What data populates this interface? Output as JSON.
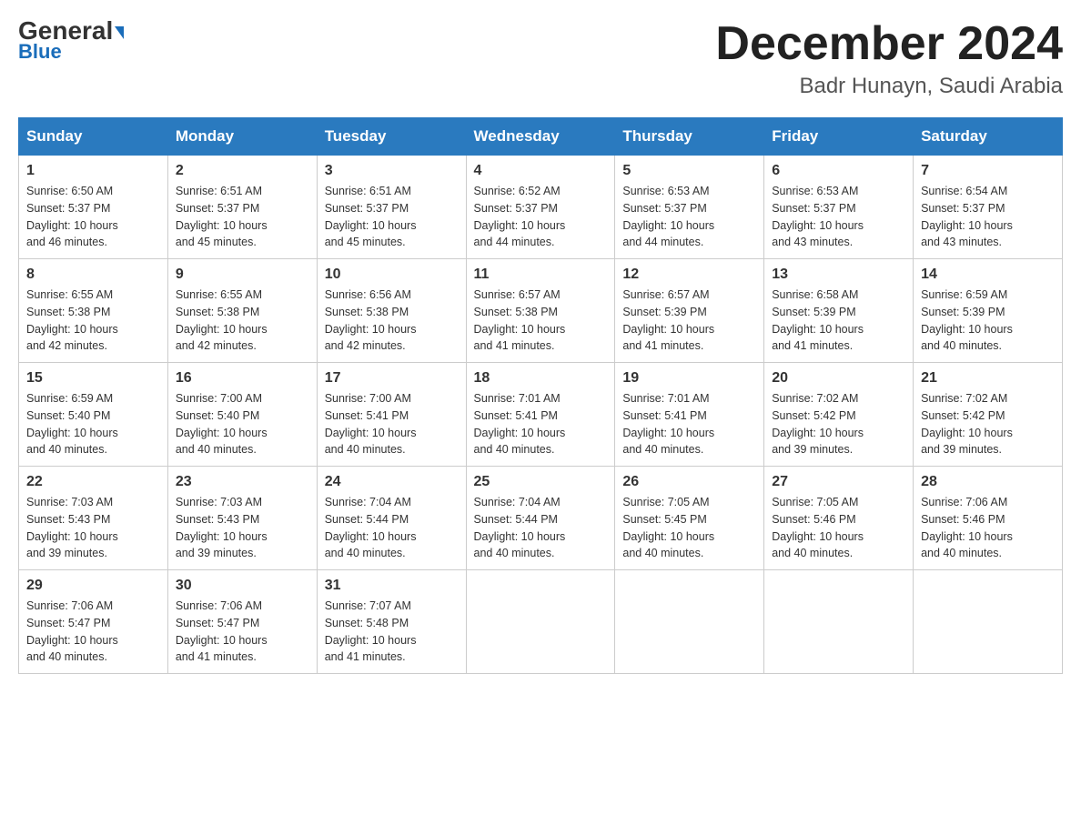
{
  "logo": {
    "general": "General",
    "blue": "Blue"
  },
  "title": "December 2024",
  "location": "Badr Hunayn, Saudi Arabia",
  "days_of_week": [
    "Sunday",
    "Monday",
    "Tuesday",
    "Wednesday",
    "Thursday",
    "Friday",
    "Saturday"
  ],
  "weeks": [
    [
      {
        "day": "1",
        "sunrise": "6:50 AM",
        "sunset": "5:37 PM",
        "daylight": "10 hours and 46 minutes."
      },
      {
        "day": "2",
        "sunrise": "6:51 AM",
        "sunset": "5:37 PM",
        "daylight": "10 hours and 45 minutes."
      },
      {
        "day": "3",
        "sunrise": "6:51 AM",
        "sunset": "5:37 PM",
        "daylight": "10 hours and 45 minutes."
      },
      {
        "day": "4",
        "sunrise": "6:52 AM",
        "sunset": "5:37 PM",
        "daylight": "10 hours and 44 minutes."
      },
      {
        "day": "5",
        "sunrise": "6:53 AM",
        "sunset": "5:37 PM",
        "daylight": "10 hours and 44 minutes."
      },
      {
        "day": "6",
        "sunrise": "6:53 AM",
        "sunset": "5:37 PM",
        "daylight": "10 hours and 43 minutes."
      },
      {
        "day": "7",
        "sunrise": "6:54 AM",
        "sunset": "5:37 PM",
        "daylight": "10 hours and 43 minutes."
      }
    ],
    [
      {
        "day": "8",
        "sunrise": "6:55 AM",
        "sunset": "5:38 PM",
        "daylight": "10 hours and 42 minutes."
      },
      {
        "day": "9",
        "sunrise": "6:55 AM",
        "sunset": "5:38 PM",
        "daylight": "10 hours and 42 minutes."
      },
      {
        "day": "10",
        "sunrise": "6:56 AM",
        "sunset": "5:38 PM",
        "daylight": "10 hours and 42 minutes."
      },
      {
        "day": "11",
        "sunrise": "6:57 AM",
        "sunset": "5:38 PM",
        "daylight": "10 hours and 41 minutes."
      },
      {
        "day": "12",
        "sunrise": "6:57 AM",
        "sunset": "5:39 PM",
        "daylight": "10 hours and 41 minutes."
      },
      {
        "day": "13",
        "sunrise": "6:58 AM",
        "sunset": "5:39 PM",
        "daylight": "10 hours and 41 minutes."
      },
      {
        "day": "14",
        "sunrise": "6:59 AM",
        "sunset": "5:39 PM",
        "daylight": "10 hours and 40 minutes."
      }
    ],
    [
      {
        "day": "15",
        "sunrise": "6:59 AM",
        "sunset": "5:40 PM",
        "daylight": "10 hours and 40 minutes."
      },
      {
        "day": "16",
        "sunrise": "7:00 AM",
        "sunset": "5:40 PM",
        "daylight": "10 hours and 40 minutes."
      },
      {
        "day": "17",
        "sunrise": "7:00 AM",
        "sunset": "5:41 PM",
        "daylight": "10 hours and 40 minutes."
      },
      {
        "day": "18",
        "sunrise": "7:01 AM",
        "sunset": "5:41 PM",
        "daylight": "10 hours and 40 minutes."
      },
      {
        "day": "19",
        "sunrise": "7:01 AM",
        "sunset": "5:41 PM",
        "daylight": "10 hours and 40 minutes."
      },
      {
        "day": "20",
        "sunrise": "7:02 AM",
        "sunset": "5:42 PM",
        "daylight": "10 hours and 39 minutes."
      },
      {
        "day": "21",
        "sunrise": "7:02 AM",
        "sunset": "5:42 PM",
        "daylight": "10 hours and 39 minutes."
      }
    ],
    [
      {
        "day": "22",
        "sunrise": "7:03 AM",
        "sunset": "5:43 PM",
        "daylight": "10 hours and 39 minutes."
      },
      {
        "day": "23",
        "sunrise": "7:03 AM",
        "sunset": "5:43 PM",
        "daylight": "10 hours and 39 minutes."
      },
      {
        "day": "24",
        "sunrise": "7:04 AM",
        "sunset": "5:44 PM",
        "daylight": "10 hours and 40 minutes."
      },
      {
        "day": "25",
        "sunrise": "7:04 AM",
        "sunset": "5:44 PM",
        "daylight": "10 hours and 40 minutes."
      },
      {
        "day": "26",
        "sunrise": "7:05 AM",
        "sunset": "5:45 PM",
        "daylight": "10 hours and 40 minutes."
      },
      {
        "day": "27",
        "sunrise": "7:05 AM",
        "sunset": "5:46 PM",
        "daylight": "10 hours and 40 minutes."
      },
      {
        "day": "28",
        "sunrise": "7:06 AM",
        "sunset": "5:46 PM",
        "daylight": "10 hours and 40 minutes."
      }
    ],
    [
      {
        "day": "29",
        "sunrise": "7:06 AM",
        "sunset": "5:47 PM",
        "daylight": "10 hours and 40 minutes."
      },
      {
        "day": "30",
        "sunrise": "7:06 AM",
        "sunset": "5:47 PM",
        "daylight": "10 hours and 41 minutes."
      },
      {
        "day": "31",
        "sunrise": "7:07 AM",
        "sunset": "5:48 PM",
        "daylight": "10 hours and 41 minutes."
      },
      null,
      null,
      null,
      null
    ]
  ],
  "labels": {
    "sunrise": "Sunrise:",
    "sunset": "Sunset:",
    "daylight": "Daylight:"
  }
}
